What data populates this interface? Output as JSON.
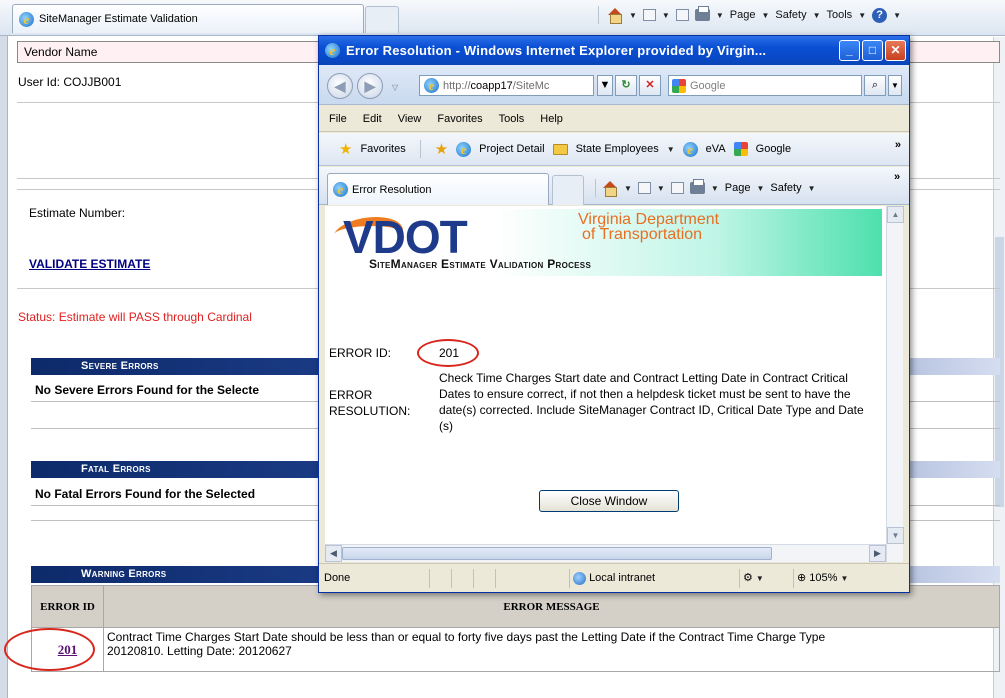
{
  "browser": {
    "tab_title": "SiteManager Estimate Validation",
    "cmd": {
      "page": "Page",
      "safety": "Safety",
      "tools": "Tools"
    }
  },
  "page": {
    "vendor_label": "Vendor Name",
    "user_id": "User Id: COJJB001",
    "estimate_number_label": "Estimate Number:",
    "validate_link": "VALIDATE ESTIMATE",
    "status": "Status: Estimate will PASS through Cardinal",
    "severe": {
      "header": "Severe Errors",
      "message": "No Severe Errors Found for the Selecte"
    },
    "fatal": {
      "header": "Fatal Errors",
      "message": "No Fatal Errors Found for the Selected"
    },
    "warning": {
      "header": "Warning Errors",
      "columns": [
        "ERROR ID",
        "ERROR MESSAGE"
      ],
      "rows": [
        {
          "id": "201",
          "message_line1": "Contract Time Charges Start Date should be less than or equal to forty five days past the Letting Date if the Contract Time Charge Type",
          "message_line2": "20120810. Letting Date: 20120627"
        }
      ]
    }
  },
  "popup": {
    "title": "Error Resolution - Windows Internet Explorer provided by Virgin...",
    "url_prefix": "http://",
    "url_host": "coapp17",
    "url_rest": "/SiteMc",
    "search_placeholder": "Google",
    "menu": [
      "File",
      "Edit",
      "View",
      "Favorites",
      "Tools",
      "Help"
    ],
    "favorites_label": "Favorites",
    "favorites": [
      "Project Detail",
      "State Employees",
      "eVA",
      "Google"
    ],
    "tab_title": "Error Resolution",
    "cmd": {
      "page": "Page",
      "safety": "Safety"
    },
    "banner": {
      "logo": "VDOT",
      "dept_line1": "Virginia Department",
      "dept_line2": "of Transportation",
      "process": "SiteManager Estimate Validation Process"
    },
    "error_id_label": "ERROR ID:",
    "error_id": "201",
    "resolution_label_1": "ERROR",
    "resolution_label_2": "RESOLUTION:",
    "resolution_text": "Check Time Charges Start date and Contract Letting Date in Contract Critical Dates to ensure correct, if not then a helpdesk ticket must be sent to have the date(s) corrected. Include SiteManager Contract ID, Critical Date Type and Date (s)",
    "close_button": "Close Window",
    "status": {
      "text": "Done",
      "zone": "Local intranet",
      "zoom": "105%"
    }
  },
  "colors": {
    "section_header": "#1e3f8c",
    "status_text": "#e02020",
    "annotation_oval": "#d9261c",
    "titlebar": "#0a4fd4"
  }
}
